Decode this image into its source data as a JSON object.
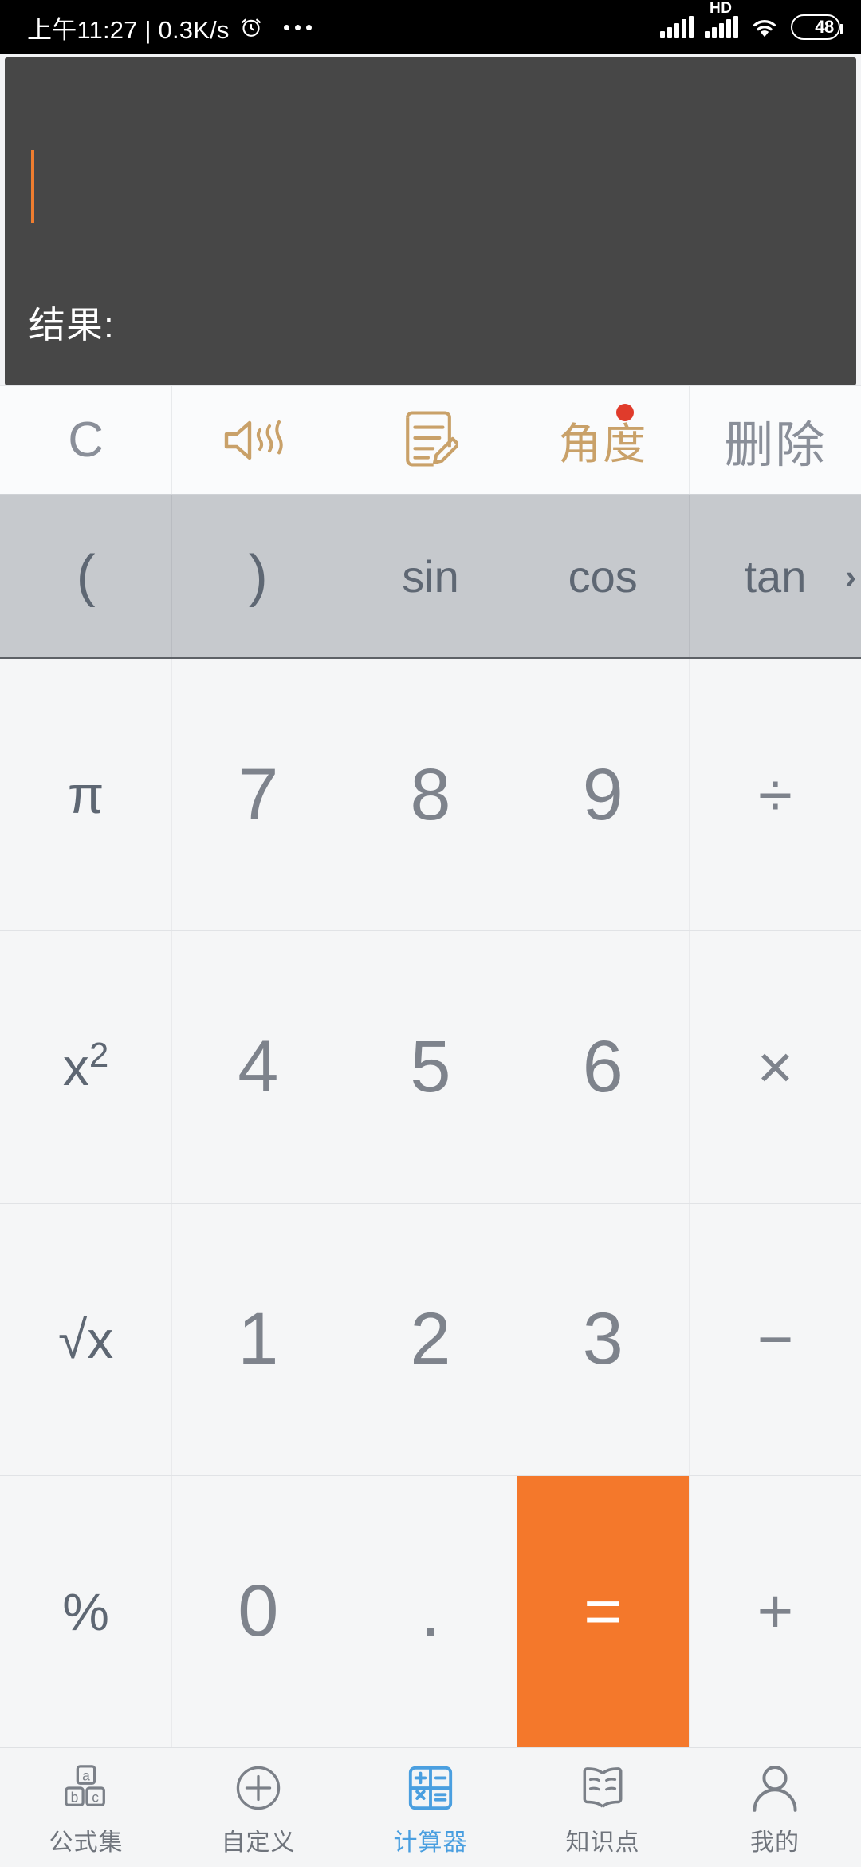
{
  "status_bar": {
    "time_text": "上午11:27 | 0.3K/s",
    "alarm_icon": "alarm-clock-icon",
    "overflow_icon": "more-dots-icon",
    "signal_icon": "cellular-signal-icon",
    "hd_label": "HD",
    "hd_signal_icon": "cellular-signal-hd-icon",
    "wifi_icon": "wifi-icon",
    "battery_level": "48"
  },
  "display": {
    "expression": "",
    "cursor_visible": true,
    "result_label": "结果:",
    "result_value": "",
    "background_color": "#474747",
    "cursor_color": "#ef7d2f"
  },
  "function_row": [
    {
      "label": "C",
      "name": "clear-button",
      "kind": "text",
      "color": "#8a8f99"
    },
    {
      "label": "",
      "name": "sound-toggle-button",
      "kind": "icon",
      "icon": "speaker-wave-icon",
      "color": "#c9a169"
    },
    {
      "label": "",
      "name": "notes-button",
      "kind": "icon",
      "icon": "note-pencil-icon",
      "color": "#c9a169"
    },
    {
      "label": "角度",
      "name": "angle-mode-button",
      "kind": "text",
      "color": "#c9a169",
      "badge": true
    },
    {
      "label": "删除",
      "name": "delete-button",
      "kind": "text",
      "color": "#8a8f99"
    }
  ],
  "trig_row": {
    "keys": [
      "(",
      ")",
      "sin",
      "cos",
      "tan"
    ],
    "scroll_chevron": "›",
    "background_color": "#c6c9cd"
  },
  "keypad": {
    "rows": [
      [
        {
          "label": "π",
          "name": "pi-key",
          "type": "fnc"
        },
        {
          "label": "7",
          "name": "digit-7-key",
          "type": "num"
        },
        {
          "label": "8",
          "name": "digit-8-key",
          "type": "num"
        },
        {
          "label": "9",
          "name": "digit-9-key",
          "type": "num"
        },
        {
          "label": "÷",
          "name": "divide-key",
          "type": "op"
        }
      ],
      [
        {
          "label": "x²",
          "name": "square-key",
          "type": "fnc"
        },
        {
          "label": "4",
          "name": "digit-4-key",
          "type": "num"
        },
        {
          "label": "5",
          "name": "digit-5-key",
          "type": "num"
        },
        {
          "label": "6",
          "name": "digit-6-key",
          "type": "num"
        },
        {
          "label": "×",
          "name": "multiply-key",
          "type": "op"
        }
      ],
      [
        {
          "label": "√x",
          "name": "sqrt-key",
          "type": "fnc"
        },
        {
          "label": "1",
          "name": "digit-1-key",
          "type": "num"
        },
        {
          "label": "2",
          "name": "digit-2-key",
          "type": "num"
        },
        {
          "label": "3",
          "name": "digit-3-key",
          "type": "num"
        },
        {
          "label": "−",
          "name": "minus-key",
          "type": "op"
        }
      ],
      [
        {
          "label": "%",
          "name": "percent-key",
          "type": "fnc"
        },
        {
          "label": "0",
          "name": "digit-0-key",
          "type": "num"
        },
        {
          "label": ".",
          "name": "decimal-key",
          "type": "dot"
        },
        {
          "label": "=",
          "name": "equals-key",
          "type": "eq"
        },
        {
          "label": "+",
          "name": "plus-key",
          "type": "op"
        }
      ]
    ],
    "equals_color": "#f4782b"
  },
  "bottom_nav": {
    "active_index": 2,
    "active_color": "#4a9fe0",
    "items": [
      {
        "label": "公式集",
        "name": "nav-formulas",
        "icon": "abc-blocks-icon"
      },
      {
        "label": "自定义",
        "name": "nav-custom",
        "icon": "plus-circle-icon"
      },
      {
        "label": "计算器",
        "name": "nav-calculator",
        "icon": "calculator-grid-icon"
      },
      {
        "label": "知识点",
        "name": "nav-knowledge",
        "icon": "open-book-icon"
      },
      {
        "label": "我的",
        "name": "nav-profile",
        "icon": "person-icon"
      }
    ]
  }
}
